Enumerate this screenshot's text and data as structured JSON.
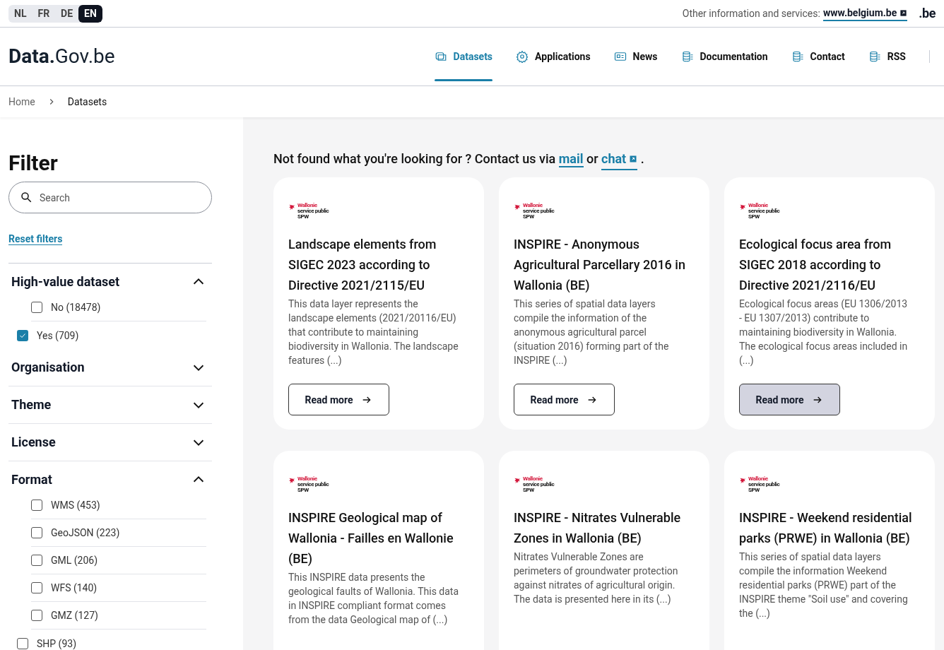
{
  "languages": [
    {
      "label": "NL",
      "selected": false
    },
    {
      "label": "FR",
      "selected": false
    },
    {
      "label": "DE",
      "selected": false
    },
    {
      "label": "EN",
      "selected": true
    }
  ],
  "services": {
    "label": "Other information and services:",
    "link": "www.belgium.be",
    "brand": ".be"
  },
  "logo": {
    "bold": "Data.",
    "rest": "Gov.be"
  },
  "nav": [
    {
      "label": "Datasets",
      "kind": "datasets",
      "selected": true
    },
    {
      "label": "Applications",
      "kind": "gear",
      "selected": false
    },
    {
      "label": "News",
      "kind": "news",
      "selected": false
    },
    {
      "label": "Documentation",
      "kind": "stack",
      "selected": false
    },
    {
      "label": "Contact",
      "kind": "stack",
      "selected": false
    },
    {
      "label": "RSS",
      "kind": "stack",
      "selected": false
    }
  ],
  "breadcrumb": [
    "Home",
    "Datasets"
  ],
  "filter": {
    "title": "Filter",
    "search_placeholder": "Search",
    "reset": "Reset filters",
    "sections": [
      {
        "title": "High-value dataset",
        "expanded": true,
        "options": [
          {
            "label": "No (18478)",
            "checked": false
          },
          {
            "label": "Yes (709)",
            "checked": true
          }
        ]
      },
      {
        "title": "Organisation",
        "expanded": false
      },
      {
        "title": "Theme",
        "expanded": false
      },
      {
        "title": "License",
        "expanded": false
      },
      {
        "title": "Format",
        "expanded": true,
        "options": [
          {
            "label": "WMS (453)",
            "checked": false
          },
          {
            "label": "GeoJSON (223)",
            "checked": false
          },
          {
            "label": "GML (206)",
            "checked": false
          },
          {
            "label": "WFS (140)",
            "checked": false
          },
          {
            "label": "GMZ (127)",
            "checked": false
          },
          {
            "label": "SHP (93)",
            "checked": false
          }
        ]
      }
    ]
  },
  "contact_line": {
    "text": "Not found what you're looking for ? Contact us via",
    "mail": "mail",
    "or": "or",
    "chat": "chat",
    "end": "."
  },
  "cards": [
    {
      "logo": [
        "Wallonie",
        "service public",
        "SPW"
      ],
      "title": "Landscape elements from SIGEC 2023 according to Directive 2021/2115/EU",
      "description": "This data layer represents the landscape elements (2021/20116/EU) that contribute to maintaining biodiversity in Wallonia. The landscape features (...)",
      "button": "Read more",
      "highlighted": false
    },
    {
      "logo": [
        "Wallonie",
        "service public",
        "SPW"
      ],
      "title": "INSPIRE - Anonymous Agricultural Parcellary 2016 in Wallonia (BE)",
      "description": "This series of spatial data layers compile the information of the anonymous agricultural parcel (situation 2016) forming part of the INSPIRE (...)",
      "button": "Read more",
      "highlighted": false
    },
    {
      "logo": [
        "Wallonie",
        "service public",
        "SPW"
      ],
      "title": "Ecological focus area from SIGEC 2018 according to Directive 2021/2116/EU",
      "description": "Ecological focus areas (EU 1306/2013 - EU 1307/2013) contribute to maintaining biodiversity in Wallonia. The ecological focus areas included in (...)",
      "button": "Read more",
      "highlighted": true
    },
    {
      "logo": [
        "Wallonie",
        "service public",
        "SPW"
      ],
      "title": "INSPIRE Geological map of Wallonia - Failles en Wallonie (BE)",
      "description": "This INSPIRE data presents the geological faults of Wallonia. This data in INSPIRE compliant format comes from the data Geological map of (...)"
    },
    {
      "logo": [
        "Wallonie",
        "service public",
        "SPW"
      ],
      "title": "INSPIRE - Nitrates Vulnerable Zones in Wallonia (BE)",
      "description": "Nitrates Vulnerable Zones are perimeters of groundwater protection against nitrates of agricultural origin. The data is presented here in its (...)"
    },
    {
      "logo": [
        "Wallonie",
        "service public",
        "SPW"
      ],
      "title": "INSPIRE - Weekend residential parks (PRWE) in Wallonia (BE)",
      "description": "This series of spatial data layers compile the information Weekend residential parks (PRWE) part of the INSPIRE theme \"Soil use\" and covering the (...)"
    }
  ]
}
